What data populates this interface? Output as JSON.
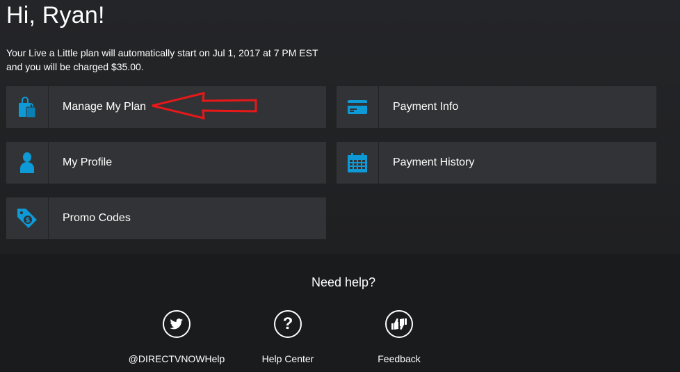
{
  "greeting": "Hi, Ryan!",
  "plan_notice": {
    "line1": "Your Live a Little plan will automatically start on Jul 1, 2017 at 7 PM EST",
    "line2": "and you will be charged $35.00."
  },
  "tiles": [
    {
      "label": "Manage My Plan",
      "icon": "shopping-bags-icon"
    },
    {
      "label": "Payment Info",
      "icon": "credit-card-icon"
    },
    {
      "label": "My Profile",
      "icon": "person-icon"
    },
    {
      "label": "Payment History",
      "icon": "calendar-icon"
    },
    {
      "label": "Promo Codes",
      "icon": "price-tag-icon"
    }
  ],
  "help": {
    "title": "Need help?",
    "links": [
      {
        "label": "@DIRECTVNOWHelp",
        "icon": "twitter-icon"
      },
      {
        "label": "Help Center",
        "icon": "question-mark-icon"
      },
      {
        "label": "Feedback",
        "icon": "thumbs-icon"
      }
    ]
  },
  "colors": {
    "accent": "#0d9ad6",
    "tile_bg": "#323336",
    "annotation_arrow": "#e81818"
  }
}
